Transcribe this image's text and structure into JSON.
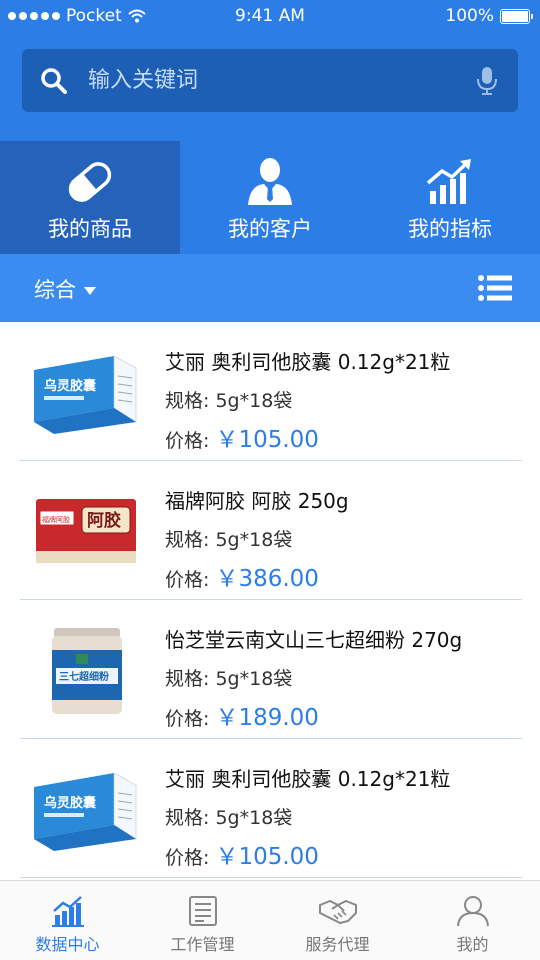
{
  "status": {
    "carrier": "Pocket",
    "time": "9:41 AM",
    "battery": "100%"
  },
  "search": {
    "placeholder": "输入关键词"
  },
  "tabs": [
    {
      "label": "我的商品",
      "icon": "pill-icon",
      "active": true
    },
    {
      "label": "我的客户",
      "icon": "customer-icon",
      "active": false
    },
    {
      "label": "我的指标",
      "icon": "chart-trend-icon",
      "active": false
    }
  ],
  "filter": {
    "sort_label": "综合"
  },
  "products": [
    {
      "name": "艾丽 奥利司他胶囊 0.12g*21粒",
      "spec_label": "规格:",
      "spec": "5g*18袋",
      "price_label": "价格:",
      "price": "￥105.00",
      "image": "乌灵胶囊",
      "image_sub": ""
    },
    {
      "name": "福牌阿胶 阿胶 250g",
      "spec_label": "规格:",
      "spec": "5g*18袋",
      "price_label": "价格:",
      "price": "￥386.00",
      "image": "阿胶",
      "image_sub": "福牌阿胶"
    },
    {
      "name": "怡芝堂云南文山三七超细粉 270g",
      "spec_label": "规格:",
      "spec": "5g*18袋",
      "price_label": "价格:",
      "price": "￥189.00",
      "image": "三七超细粉",
      "image_sub": ""
    },
    {
      "name": "艾丽 奥利司他胶囊 0.12g*21粒",
      "spec_label": "规格:",
      "spec": "5g*18袋",
      "price_label": "价格:",
      "price": "￥105.00",
      "image": "乌灵胶囊",
      "image_sub": ""
    }
  ],
  "tabbar": [
    {
      "label": "数据中心",
      "icon": "data-center-icon",
      "active": true
    },
    {
      "label": "工作管理",
      "icon": "work-list-icon",
      "active": false
    },
    {
      "label": "服务代理",
      "icon": "handshake-icon",
      "active": false
    },
    {
      "label": "我的",
      "icon": "profile-icon",
      "active": false
    }
  ],
  "colors": {
    "primary": "#2c7de6",
    "active_tab": "#2463b9",
    "search_bg": "#1c5fb4",
    "filter_bar": "#3b8cf0"
  }
}
